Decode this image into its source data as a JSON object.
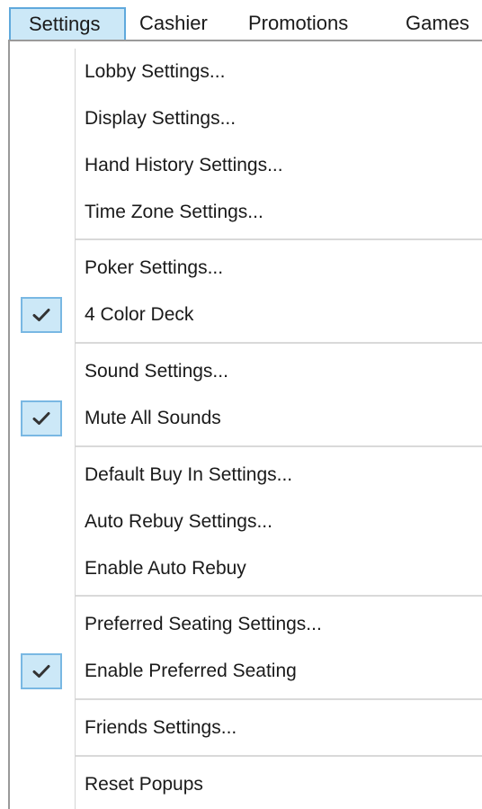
{
  "menubar": {
    "items": [
      {
        "label": "Settings",
        "active": true
      },
      {
        "label": "Cashier",
        "active": false
      },
      {
        "label": "Promotions",
        "active": false
      },
      {
        "label": "Games",
        "active": false
      }
    ]
  },
  "menu": {
    "groups": [
      {
        "items": [
          {
            "label": "Lobby Settings...",
            "checked": false
          },
          {
            "label": "Display Settings...",
            "checked": false
          },
          {
            "label": "Hand History Settings...",
            "checked": false
          },
          {
            "label": "Time Zone Settings...",
            "checked": false
          }
        ]
      },
      {
        "items": [
          {
            "label": "Poker Settings...",
            "checked": false
          },
          {
            "label": "4 Color Deck",
            "checked": true
          }
        ]
      },
      {
        "items": [
          {
            "label": "Sound Settings...",
            "checked": false
          },
          {
            "label": "Mute All Sounds",
            "checked": true
          }
        ]
      },
      {
        "items": [
          {
            "label": "Default Buy In Settings...",
            "checked": false
          },
          {
            "label": "Auto Rebuy Settings...",
            "checked": false
          },
          {
            "label": "Enable Auto Rebuy",
            "checked": false
          }
        ]
      },
      {
        "items": [
          {
            "label": "Preferred Seating Settings...",
            "checked": false
          },
          {
            "label": "Enable Preferred Seating",
            "checked": true
          }
        ]
      },
      {
        "items": [
          {
            "label": "Friends Settings...",
            "checked": false
          }
        ]
      },
      {
        "items": [
          {
            "label": "Reset Popups",
            "checked": false
          }
        ]
      }
    ]
  },
  "colors": {
    "highlight_bg": "#cce8f7",
    "highlight_border": "#5fa9dc",
    "separator": "#d9d9d9"
  },
  "icons": {
    "check": "check-icon"
  }
}
